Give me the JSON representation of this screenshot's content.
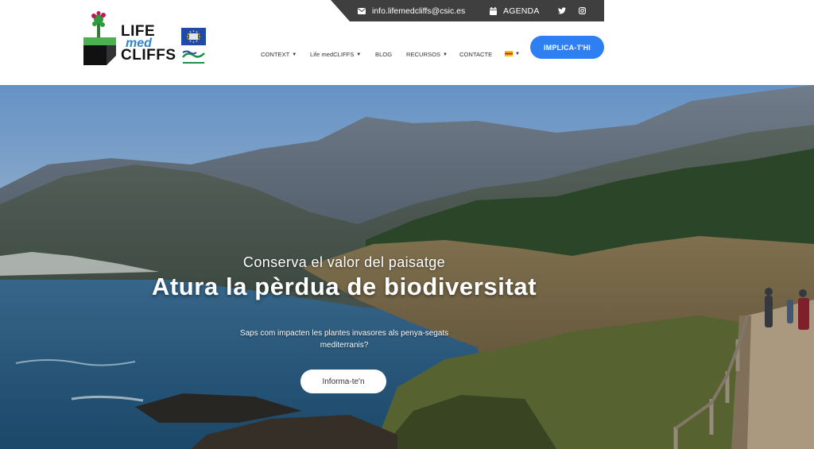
{
  "topbar": {
    "email": "info.lifemedcliffs@csic.es",
    "agenda": "AGENDA",
    "icons": [
      "email-icon",
      "calendar-icon",
      "twitter-icon",
      "instagram-icon"
    ]
  },
  "logo": {
    "line1": "LIFE",
    "line2": "med",
    "line3": "CLIFFS"
  },
  "nav": {
    "items": [
      {
        "label": "CONTEXT",
        "dropdown": true
      },
      {
        "label": "Life medCLIFFS",
        "dropdown": true
      },
      {
        "label": "BLOG",
        "dropdown": false
      },
      {
        "label": "RECURSOS",
        "dropdown": true
      },
      {
        "label": "CONTACTE",
        "dropdown": false
      }
    ],
    "language_flag": "catalan-flag-icon"
  },
  "cta": {
    "label": "IMPLICA-T'HI"
  },
  "hero": {
    "kicker": "Conserva el valor del paisatge",
    "title": "Atura la pèrdua de biodiversitat",
    "subtitle": "Saps com impacten les plantes invasores als penya-segats mediterranis?",
    "button": "Informa-te'n"
  },
  "colors": {
    "accent": "#2d7ff2",
    "topbar": "#3f3f3f",
    "logo_blue": "#2e83cf",
    "logo_green": "#2e7d32"
  }
}
